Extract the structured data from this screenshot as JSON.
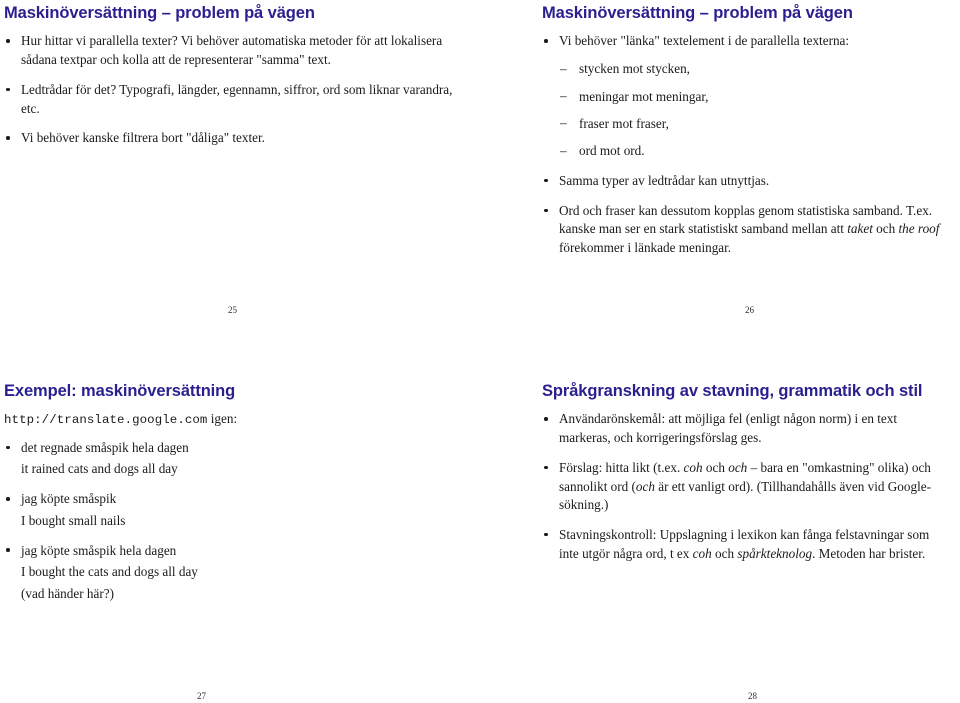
{
  "document": {
    "type": "lecture-slide-handout",
    "slide_count": 4,
    "title_color": "#2a1f8f",
    "text_color": "#1a1a1a",
    "background_color": "#ffffff"
  },
  "slides": [
    {
      "id": "slide-25",
      "position": "top-left",
      "title": "Maskinöversättning – problem på vägen",
      "page_number": "25",
      "bullets": [
        "Hur hittar vi parallella texter? Vi behöver automatiska metoder för att lokalisera sådana textpar och kolla att de representerar \"samma\" text.",
        "Ledtrådar för det? Typografi, längder, egennamn, siffror, ord som liknar varandra, etc.",
        "Vi behöver kanske filtrera bort \"dåliga\" texter."
      ]
    },
    {
      "id": "slide-26",
      "position": "top-right",
      "title": "Maskinöversättning – problem på vägen",
      "page_number": "26",
      "bullet_1": "Vi behöver \"länka\" textelement i de parallella texterna:",
      "subitems": [
        "stycken mot stycken,",
        "meningar mot meningar,",
        "fraser mot fraser,",
        "ord mot ord."
      ],
      "bullet_2": "Samma typer av ledtrådar kan utnyttjas.",
      "bullet_3_part1": "Ord och fraser kan dessutom kopplas genom statistiska samband. T.ex. kanske man ser en stark statistiskt samband mellan att ",
      "bullet_3_italic1": "taket",
      "bullet_3_part2": " och ",
      "bullet_3_italic2": "the roof",
      "bullet_3_part3": " förekommer i länkade meningar."
    },
    {
      "id": "slide-27",
      "position": "bottom-left",
      "title": "Exempel: maskinöversättning",
      "page_number": "27",
      "url": "http://translate.google.com",
      "url_suffix": " igen:",
      "pairs": [
        {
          "source": "det regnade småspik hela dagen",
          "target": "it rained cats and dogs all day"
        },
        {
          "source": "jag köpte småspik",
          "target": "I bought small nails"
        },
        {
          "source": "jag köpte småspik hela dagen",
          "target": "I bought the cats and dogs all day",
          "note": "(vad händer här?)"
        }
      ]
    },
    {
      "id": "slide-28",
      "position": "bottom-right",
      "title": "Språkgranskning av stavning, grammatik och stil",
      "page_number": "28",
      "bullet_1": "Användarönskemål: att möjliga fel (enligt någon norm) i en text markeras, och korrigeringsförslag ges.",
      "bullet_2_part1": "Förslag: hitta likt (t.ex. ",
      "bullet_2_italic1": "coh",
      "bullet_2_part2": " och ",
      "bullet_2_italic2": "och",
      "bullet_2_part3": " – bara en \"omkastning\" olika) och sannolikt ord (",
      "bullet_2_italic3": "och",
      "bullet_2_part4": " är ett vanligt ord). (Tillhandahålls även vid Google-sökning.)",
      "bullet_3_part1": "Stavningskontroll: Uppslagning i lexikon kan fånga felstavningar som inte utgör några ord, t ex ",
      "bullet_3_italic1": "coh",
      "bullet_3_part2": " och ",
      "bullet_3_italic2": "spårkteknolog",
      "bullet_3_part3": ". Metoden har brister."
    }
  ]
}
